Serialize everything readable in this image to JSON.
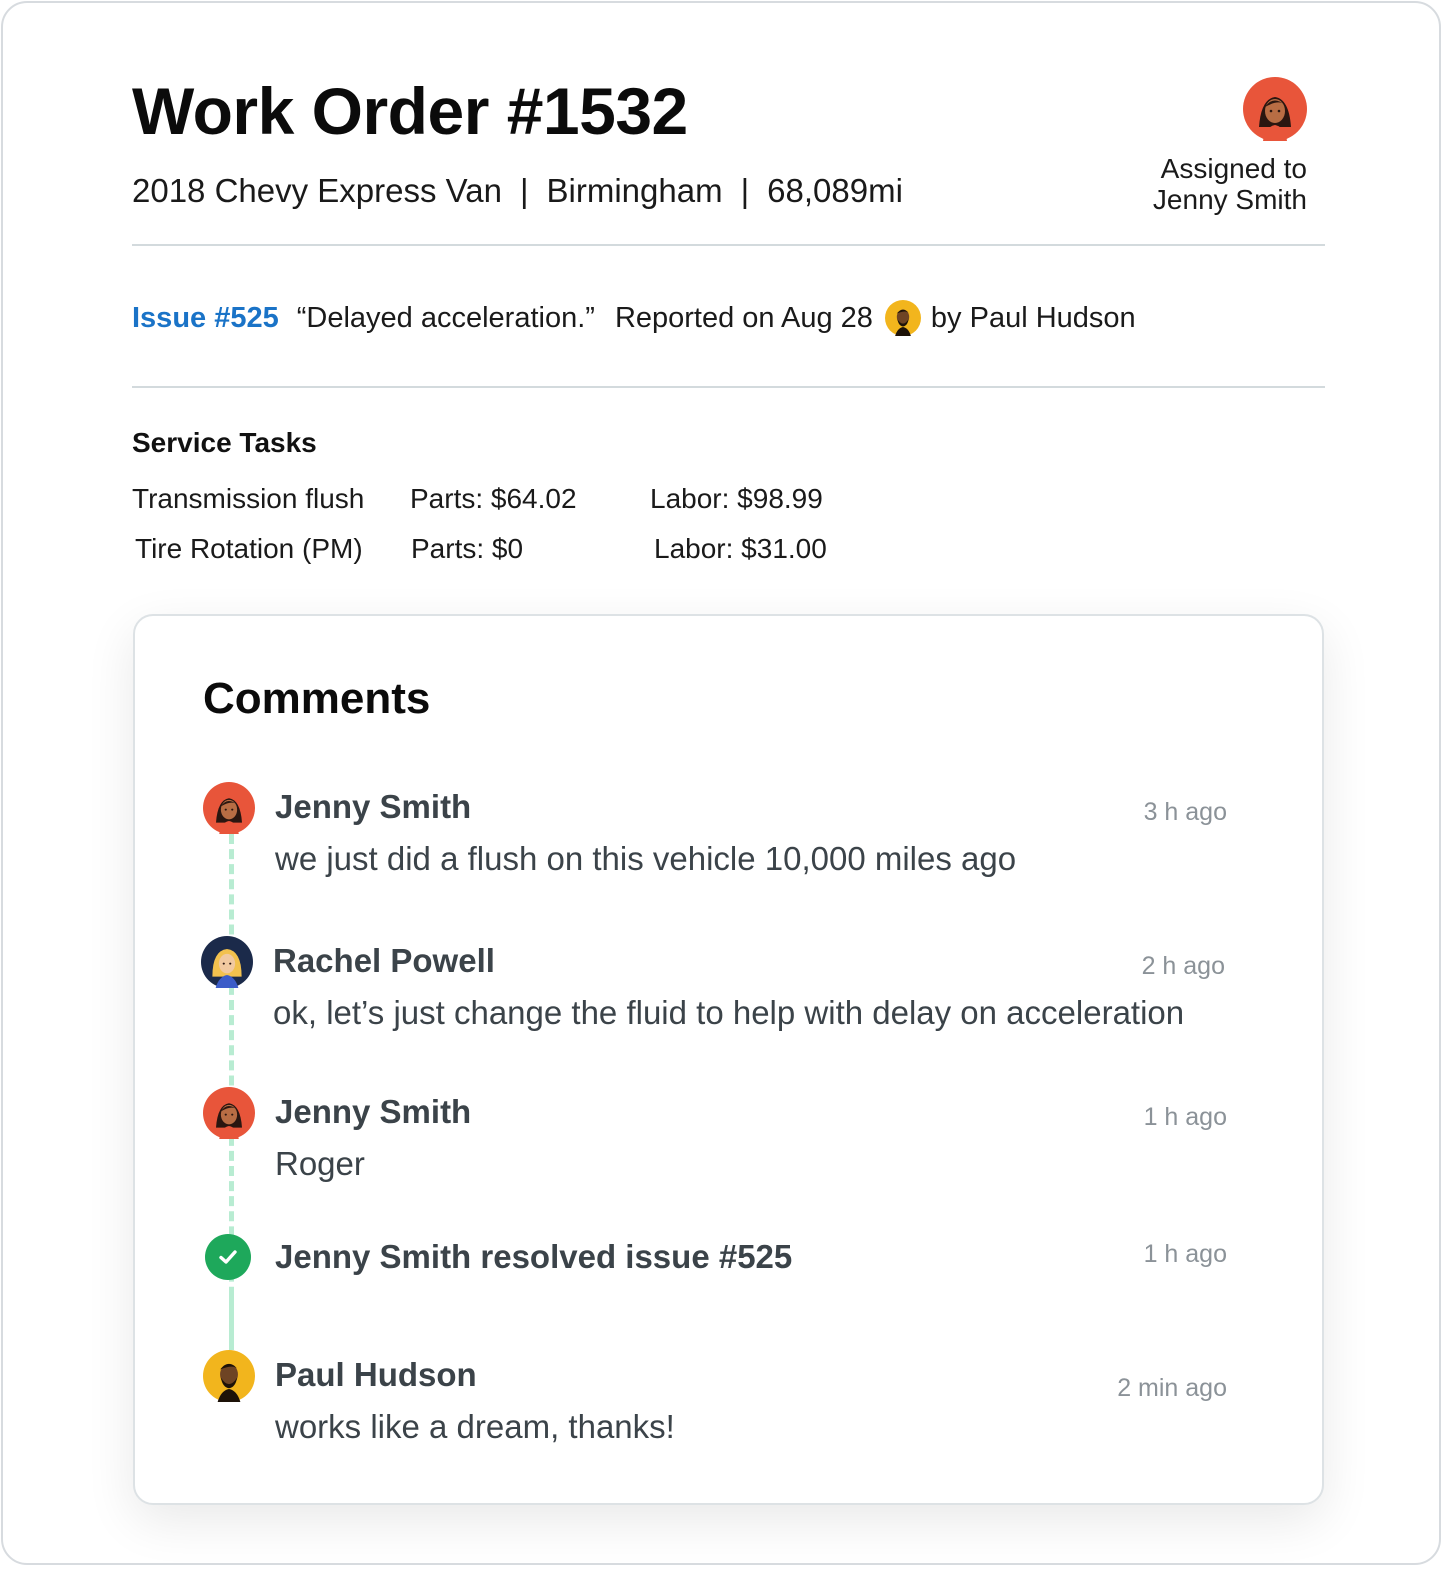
{
  "header": {
    "title": "Work Order #1532",
    "vehicle": "2018 Chevy Express Van",
    "location": "Birmingham",
    "mileage": "68,089mi",
    "separator": "|",
    "assigned_label": "Assigned to",
    "assignee": "Jenny Smith"
  },
  "issue": {
    "link": "Issue #525",
    "quote": "“Delayed acceleration.”",
    "reported": "Reported on Aug 28",
    "by": "by Paul Hudson",
    "link_color": "#1a73c7"
  },
  "service_tasks": {
    "title": "Service Tasks",
    "rows": [
      {
        "name": "Transmission flush",
        "parts": "Parts: $64.02",
        "labor": "Labor: $98.99"
      },
      {
        "name": "Tire Rotation (PM)",
        "parts": "Parts: $0",
        "labor": "Labor: $31.00"
      }
    ]
  },
  "comments": {
    "title": "Comments",
    "items": [
      {
        "author": "Jenny Smith",
        "time": "3 h ago",
        "text": "we just did a flush on this vehicle 10,000 miles ago",
        "avatar": "jenny-avatar"
      },
      {
        "author": "Rachel Powell",
        "time": "2 h ago",
        "text": "ok, let’s just change the fluid to help with delay on acceleration",
        "avatar": "rachel-avatar"
      },
      {
        "author": "Jenny Smith",
        "time": "1 h ago",
        "text": "Roger",
        "avatar": "jenny-avatar"
      },
      {
        "event": "Jenny Smith resolved issue #525",
        "time": "1 h ago",
        "icon": "check-circle-icon"
      },
      {
        "author": "Paul Hudson",
        "time": "2 min ago",
        "text": "works like a dream, thanks!",
        "avatar": "paul-avatar"
      }
    ]
  },
  "colors": {
    "timeline": "#b8ecd2",
    "resolved": "#1ea85b",
    "jenny_avatar_bg": "#e8553a",
    "rachel_avatar_bg": "#1b2a4a",
    "paul_avatar_bg": "#f2b51d"
  }
}
